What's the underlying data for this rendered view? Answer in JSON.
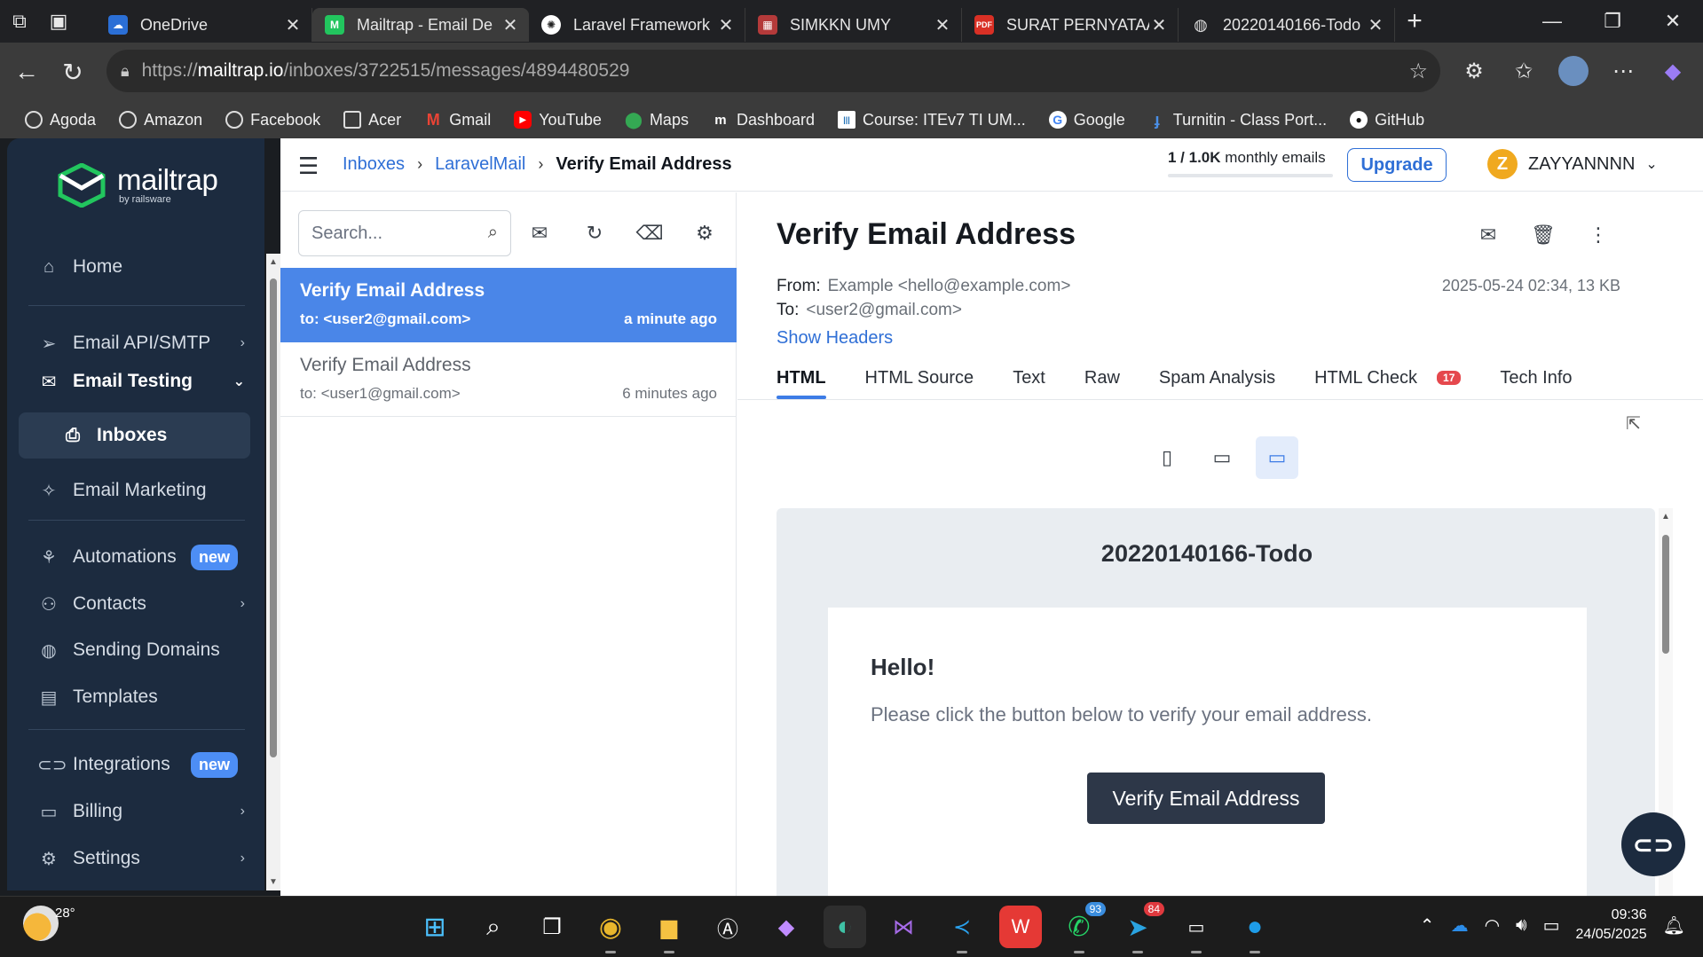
{
  "browser": {
    "tabs": [
      {
        "label": "OneDrive",
        "icon": "onedrive-cloud",
        "color": "#2b6fd6",
        "active": false
      },
      {
        "label": "Mailtrap - Email De",
        "icon": "mailtrap-logo",
        "color": "#22c55e",
        "active": true
      },
      {
        "label": "Laravel Framework",
        "icon": "openai-logo",
        "color": "#ffffff",
        "active": false
      },
      {
        "label": "SIMKKN UMY",
        "icon": "simkkn-logo",
        "color": "#b43a3a",
        "active": false
      },
      {
        "label": "SURAT PERNYATAA",
        "icon": "pdf-icon",
        "color": "#d93025",
        "active": false
      },
      {
        "label": "20220140166-Todo",
        "icon": "globe-icon",
        "color": "#cccccc",
        "active": false
      }
    ],
    "url": {
      "scheme": "https://",
      "host": "mailtrap.io",
      "path": "/inboxes/3722515/messages/4894480529"
    },
    "bookmarks": [
      {
        "label": "Agoda",
        "icon": "globe-icon"
      },
      {
        "label": "Amazon",
        "icon": "globe-icon"
      },
      {
        "label": "Facebook",
        "icon": "globe-icon"
      },
      {
        "label": "Acer",
        "icon": "folder-icon"
      },
      {
        "label": "Gmail",
        "icon": "gmail-icon"
      },
      {
        "label": "YouTube",
        "icon": "youtube-icon"
      },
      {
        "label": "Maps",
        "icon": "maps-icon"
      },
      {
        "label": "Dashboard",
        "icon": "dashboard-icon"
      },
      {
        "label": "Course: ITEv7 TI UM...",
        "icon": "cisco-icon"
      },
      {
        "label": "Google",
        "icon": "google-icon"
      },
      {
        "label": "Turnitin - Class Port...",
        "icon": "turnitin-icon"
      },
      {
        "label": "GitHub",
        "icon": "github-icon"
      }
    ]
  },
  "sidebar": {
    "brand": {
      "name": "mailtrap",
      "sub": "by railsware"
    },
    "items": [
      {
        "label": "Home",
        "icon": "home-icon"
      },
      {
        "label": "Email API/SMTP",
        "icon": "send-icon"
      },
      {
        "label": "Email Testing",
        "icon": "email-testing-icon"
      },
      {
        "label": "Inboxes",
        "icon": "inbox-icon"
      },
      {
        "label": "Email Marketing",
        "icon": "sparkle-icon"
      },
      {
        "label": "Automations",
        "icon": "automation-icon",
        "badge": "new"
      },
      {
        "label": "Contacts",
        "icon": "contacts-icon"
      },
      {
        "label": "Sending Domains",
        "icon": "globe-icon"
      },
      {
        "label": "Templates",
        "icon": "template-icon"
      },
      {
        "label": "Integrations",
        "icon": "link-icon",
        "badge": "new"
      },
      {
        "label": "Billing",
        "icon": "card-icon"
      },
      {
        "label": "Settings",
        "icon": "gear-icon"
      }
    ]
  },
  "header": {
    "breadcrumb": [
      "Inboxes",
      "LaravelMail",
      "Verify Email Address"
    ],
    "quota_used": "1 / 1.0K",
    "quota_label": "monthly emails",
    "quota_fraction": 0.001,
    "upgrade_label": "Upgrade",
    "user_initial": "Z",
    "user_name": "ZAYYANNNN"
  },
  "list": {
    "search_placeholder": "Search...",
    "messages": [
      {
        "subject": "Verify Email Address",
        "to": "to: <user2@gmail.com>",
        "time": "a minute ago",
        "selected": true
      },
      {
        "subject": "Verify Email Address",
        "to": "to: <user1@gmail.com>",
        "time": "6 minutes ago",
        "selected": false
      }
    ]
  },
  "detail": {
    "subject": "Verify Email Address",
    "from_label": "From:",
    "from_value": "Example <hello@example.com>",
    "to_label": "To:",
    "to_value": "<user2@gmail.com>",
    "date_size": "2025-05-24 02:34, 13 KB",
    "show_headers": "Show Headers",
    "tabs": [
      "HTML",
      "HTML Source",
      "Text",
      "Raw",
      "Spam Analysis",
      "HTML Check",
      "Tech Info"
    ],
    "html_check_count": "17",
    "active_tab": "HTML",
    "preview": {
      "app_name": "20220140166-Todo",
      "greeting": "Hello!",
      "body": "Please click the button below to verify your email address.",
      "button": "Verify Email Address"
    }
  },
  "taskbar": {
    "temperature": "28°",
    "whatsapp_badge": "93",
    "telegram_badge": "84",
    "time": "09:36",
    "date": "24/05/2025"
  }
}
